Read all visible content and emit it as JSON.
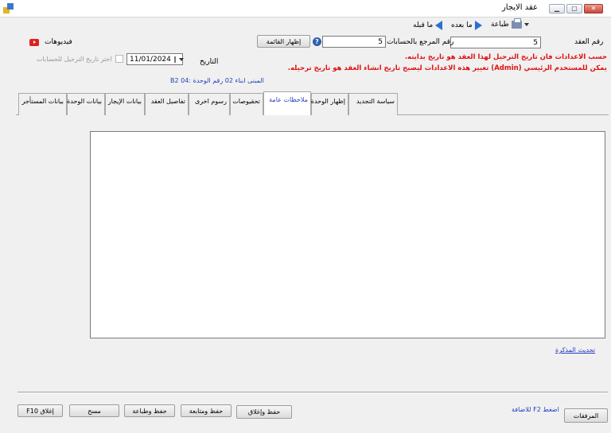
{
  "window": {
    "title": "عقد الايجار"
  },
  "toolbar": {
    "print_label": "طباعة",
    "next_label": "ما بعده",
    "prev_label": "ما قبله"
  },
  "form": {
    "contract_no_label": "رقم العقد",
    "contract_no_value": "5",
    "account_ref_label": "رقم المرجع بالحسابات",
    "account_ref_value": "5",
    "show_list_label": "إظهار القائمة",
    "videos_label": "فيديوهات",
    "date_label": "التاريخ",
    "date_value": "11/01/2024",
    "posting_date_checkbox_label": "اختر تاريخ الترحيل للحسابات",
    "warning_line1": "حسب الاعدادات فان تاريخ الترحيل لهذا العقد هو تاريخ بدايته.",
    "warning_line2": "يمكن للمستخدم الرئيسي (Admin) تغيير هذه الاعدادات ليصبح تاريخ انشاء العقد هو تاريخ ترحيله.",
    "building_info": "المبنى ابناء 02 رقم الوحدة :04 B2"
  },
  "tabs": [
    {
      "label": "بيانات المستأجر",
      "active": false
    },
    {
      "label": "بيانات الوحدة",
      "active": false
    },
    {
      "label": "بيانات الإيجار",
      "active": false
    },
    {
      "label": "تفاصيل العقد",
      "active": false
    },
    {
      "label": "رسوم اخرى",
      "active": false
    },
    {
      "label": "تحقيوصات",
      "active": false
    },
    {
      "label": "ملاحظات عامة",
      "active": true
    },
    {
      "label": "إظهار الوحدة",
      "active": false
    },
    {
      "label": "سياسة التجديد",
      "active": false
    }
  ],
  "notes": {
    "update_memo_link": "تحديث المذكرة"
  },
  "footer": {
    "attachments_label": "المرفقات",
    "press_f2_hint": "اضغط F2 للاضافة",
    "save_close_label": "حفظ وإغلاق",
    "save_continue_label": "حفظ ومتابعة",
    "save_print_label": "حفظ وطباعة",
    "clear_label": "مسح",
    "close_label": "إغلاق F10"
  },
  "colors": {
    "link_blue": "#1f3fbf",
    "warning_red": "#e01010",
    "arrow_blue": "#2a6fd6"
  }
}
